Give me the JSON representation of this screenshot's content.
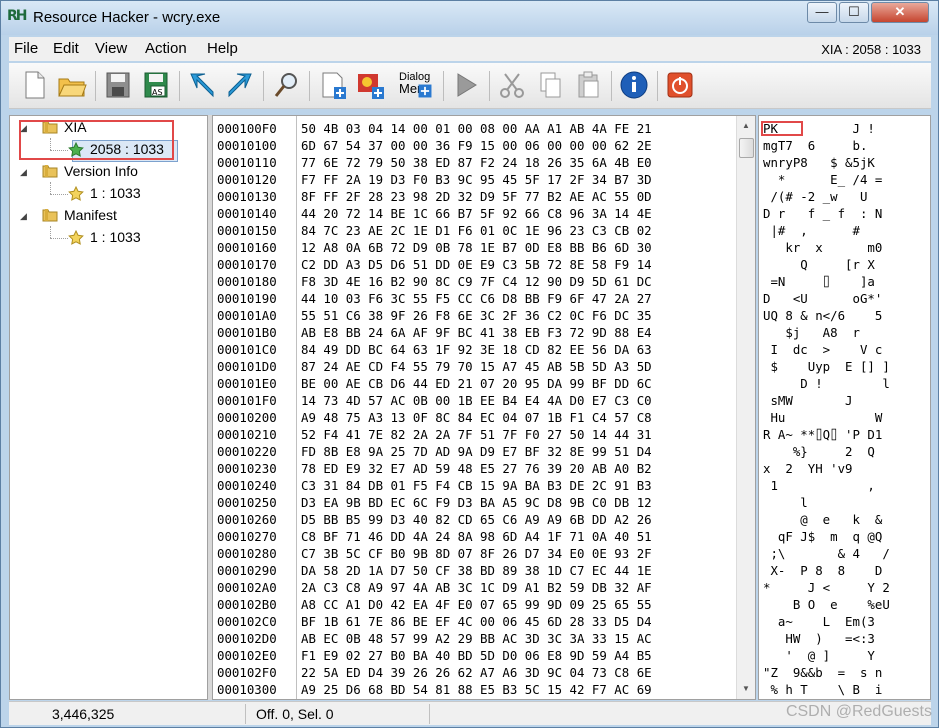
{
  "window": {
    "title": "Resource Hacker - wcry.exe",
    "logo_text": "RH",
    "minimize_glyph": "—",
    "maximize_glyph": "☐",
    "close_glyph": "✕"
  },
  "menu": {
    "items": [
      "File",
      "Edit",
      "View",
      "Action",
      "Help"
    ],
    "resource_info": "XIA : 2058 : 1033"
  },
  "toolbar": {
    "dialog_menu_label_line1": "Dialog",
    "dialog_menu_label_line2": "Mer"
  },
  "tree": {
    "nodes": [
      {
        "label": "XIA",
        "children": [
          "2058 : 1033"
        ]
      },
      {
        "label": "Version Info",
        "children": [
          "1 : 1033"
        ]
      },
      {
        "label": "Manifest",
        "children": [
          "1 : 1033"
        ]
      }
    ],
    "expand_glyph": "◢"
  },
  "hex_view": {
    "rows": [
      {
        "addr": "000100F0",
        "bytes": "50 4B 03 04 14 00 01 00 08 00 AA A1 AB 4A FE 21",
        "ascii": "PK          J !"
      },
      {
        "addr": "00010100",
        "bytes": "6D 67 54 37 00 00 36 F9 15 00 06 00 00 00 62 2E",
        "ascii": "mgT7  6     b."
      },
      {
        "addr": "00010110",
        "bytes": "77 6E 72 79 50 38 ED 87 F2 24 18 26 35 6A 4B E0",
        "ascii": "wnryP8   $ &5jK"
      },
      {
        "addr": "00010120",
        "bytes": "F7 FF 2A 19 D3 F0 B3 9C 95 45 5F 17 2F 34 B7 3D",
        "ascii": "  *      E_ /4 ="
      },
      {
        "addr": "00010130",
        "bytes": "8F FF 2F 28 23 98 2D 32 D9 5F 77 B2 AE AC 55 0D",
        "ascii": " /(# -2 _w   U"
      },
      {
        "addr": "00010140",
        "bytes": "44 20 72 14 BE 1C 66 B7 5F 92 66 C8 96 3A 14 4E",
        "ascii": "D r   f _ f  : N"
      },
      {
        "addr": "00010150",
        "bytes": "84 7C 23 AE 2C 1E D1 F6 01 0C 1E 96 23 C3 CB 02",
        "ascii": " |#  ,      #"
      },
      {
        "addr": "00010160",
        "bytes": "12 A8 0A 6B 72 D9 0B 78 1E B7 0D E8 BB B6 6D 30",
        "ascii": "   kr  x      m0"
      },
      {
        "addr": "00010170",
        "bytes": "C2 DD A3 D5 D6 51 DD 0E E9 C3 5B 72 8E 58 F9 14",
        "ascii": "     Q     [r X"
      },
      {
        "addr": "00010180",
        "bytes": "F8 3D 4E 16 B2 90 8C C9 7F C4 12 90 D9 5D 61 DC",
        "ascii": " =N     ⌷    ]a"
      },
      {
        "addr": "00010190",
        "bytes": "44 10 03 F6 3C 55 F5 CC C6 D8 BB F9 6F 47 2A 27",
        "ascii": "D   <U      oG*'"
      },
      {
        "addr": "000101A0",
        "bytes": "55 51 C6 38 9F 26 F8 6E 3C 2F 36 C2 0C F6 DC 35",
        "ascii": "UQ 8 & n</6    5"
      },
      {
        "addr": "000101B0",
        "bytes": "AB E8 BB 24 6A AF 9F BC 41 38 EB F3 72 9D 88 E4",
        "ascii": "   $j   A8  r"
      },
      {
        "addr": "000101C0",
        "bytes": "84 49 DD BC 64 63 1F 92 3E 18 CD 82 EE 56 DA 63",
        "ascii": " I  dc  >    V c"
      },
      {
        "addr": "000101D0",
        "bytes": "87 24 AE CD F4 55 79 70 15 A7 45 AB 5B 5D A3 5D",
        "ascii": " $    Uyp  E [] ]"
      },
      {
        "addr": "000101E0",
        "bytes": "BE 00 AE CB D6 44 ED 21 07 20 95 DA 99 BF DD 6C",
        "ascii": "     D !        l"
      },
      {
        "addr": "000101F0",
        "bytes": "14 73 4D 57 AC 0B 00 1B EE B4 E4 4A D0 E7 C3 C0",
        "ascii": " sMW       J"
      },
      {
        "addr": "00010200",
        "bytes": "A9 48 75 A3 13 0F 8C 84 EC 04 07 1B F1 C4 57 C8",
        "ascii": " Hu            W"
      },
      {
        "addr": "00010210",
        "bytes": "52 F4 41 7E 82 2A 2A 7F 51 7F F0 27 50 14 44 31",
        "ascii": "R A~ **⌷Q⌷ 'P D1"
      },
      {
        "addr": "00010220",
        "bytes": "FD 8B E8 9A 25 7D AD 9A D9 E7 BF 32 8E 99 51 D4",
        "ascii": "    %}     2  Q"
      },
      {
        "addr": "00010230",
        "bytes": "78 ED E9 32 E7 AD 59 48 E5 27 76 39 20 AB A0 B2",
        "ascii": "x  2  YH 'v9"
      },
      {
        "addr": "00010240",
        "bytes": "C3 31 84 DB 01 F5 F4 CB 15 9A BA B3 DE 2C 91 B3",
        "ascii": " 1            ,"
      },
      {
        "addr": "00010250",
        "bytes": "D3 EA 9B BD EC 6C F9 D3 BA A5 9C D8 9B C0 DB 12",
        "ascii": "     l"
      },
      {
        "addr": "00010260",
        "bytes": "D5 BB B5 99 D3 40 82 CD 65 C6 A9 A9 6B DD A2 26",
        "ascii": "     @  e   k  &"
      },
      {
        "addr": "00010270",
        "bytes": "C8 BF 71 46 DD 4A 24 8A 98 6D A4 1F 71 0A 40 51",
        "ascii": "  qF J$  m  q @Q"
      },
      {
        "addr": "00010280",
        "bytes": "C7 3B 5C CF B0 9B 8D 07 8F 26 D7 34 E0 0E 93 2F",
        "ascii": " ;\\       & 4   /"
      },
      {
        "addr": "00010290",
        "bytes": "DA 58 2D 1A D7 50 CF 38 BD 89 38 1D C7 EC 44 1E",
        "ascii": " X-  P 8  8    D"
      },
      {
        "addr": "000102A0",
        "bytes": "2A C3 C8 A9 97 4A AB 3C 1C D9 A1 B2 59 DB 32 AF",
        "ascii": "*     J <     Y 2"
      },
      {
        "addr": "000102B0",
        "bytes": "A8 CC A1 D0 42 EA 4F E0 07 65 99 9D 09 25 65 55",
        "ascii": "    B O  e    %eU"
      },
      {
        "addr": "000102C0",
        "bytes": "BF 1B 61 7E 86 BE EF 4C 00 06 45 6D 28 33 D5 D4",
        "ascii": "  a~    L  Em(3"
      },
      {
        "addr": "000102D0",
        "bytes": "AB EC 0B 48 57 99 A2 29 BB AC 3D 3C 3A 33 15 AC",
        "ascii": "   HW  )   =<:3"
      },
      {
        "addr": "000102E0",
        "bytes": "F1 E9 02 27 B0 BA 40 BD 5D D0 06 E8 9D 59 A4 B5",
        "ascii": "   '  @ ]     Y"
      },
      {
        "addr": "000102F0",
        "bytes": "22 5A ED D4 39 26 26 62 A7 A6 3D 9C 04 73 C8 6E",
        "ascii": "\"Z  9&&b  =  s n"
      },
      {
        "addr": "00010300",
        "bytes": "A9 25 D6 68 BD 54 81 88 E5 B3 5C 15 42 F7 AC 69",
        "ascii": " % h T    \\ B  i"
      }
    ]
  },
  "status": {
    "size": "3,446,325",
    "selection": "Off. 0, Sel. 0"
  },
  "watermark": "CSDN @RedGuests",
  "colors": {
    "highlight_border": "#e14848",
    "selection_bg": "#dbe8f6",
    "frame_bg": "#bcd4ea"
  }
}
